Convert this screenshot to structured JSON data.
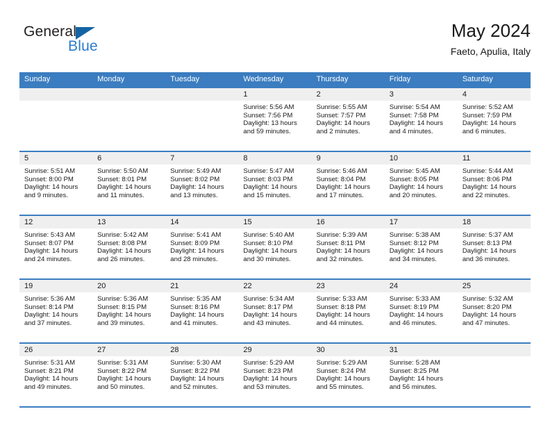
{
  "brand": {
    "name_part1": "General",
    "name_part2": "Blue",
    "logo_icon": "blue-triangle"
  },
  "header": {
    "title": "May 2024",
    "subtitle": "Faeto, Apulia, Italy"
  },
  "weekdays": [
    "Sunday",
    "Monday",
    "Tuesday",
    "Wednesday",
    "Thursday",
    "Friday",
    "Saturday"
  ],
  "colors": {
    "header_blue": "#3b7dc0",
    "daynum_band": "#efefef",
    "logo_blue": "#2b7cc9",
    "text": "#1a1a1a"
  },
  "weeks": [
    [
      {
        "day": ""
      },
      {
        "day": ""
      },
      {
        "day": ""
      },
      {
        "day": "1",
        "sunrise": "Sunrise: 5:56 AM",
        "sunset": "Sunset: 7:56 PM",
        "daylight_1": "Daylight: 13 hours",
        "daylight_2": "and 59 minutes."
      },
      {
        "day": "2",
        "sunrise": "Sunrise: 5:55 AM",
        "sunset": "Sunset: 7:57 PM",
        "daylight_1": "Daylight: 14 hours",
        "daylight_2": "and 2 minutes."
      },
      {
        "day": "3",
        "sunrise": "Sunrise: 5:54 AM",
        "sunset": "Sunset: 7:58 PM",
        "daylight_1": "Daylight: 14 hours",
        "daylight_2": "and 4 minutes."
      },
      {
        "day": "4",
        "sunrise": "Sunrise: 5:52 AM",
        "sunset": "Sunset: 7:59 PM",
        "daylight_1": "Daylight: 14 hours",
        "daylight_2": "and 6 minutes."
      }
    ],
    [
      {
        "day": "5",
        "sunrise": "Sunrise: 5:51 AM",
        "sunset": "Sunset: 8:00 PM",
        "daylight_1": "Daylight: 14 hours",
        "daylight_2": "and 9 minutes."
      },
      {
        "day": "6",
        "sunrise": "Sunrise: 5:50 AM",
        "sunset": "Sunset: 8:01 PM",
        "daylight_1": "Daylight: 14 hours",
        "daylight_2": "and 11 minutes."
      },
      {
        "day": "7",
        "sunrise": "Sunrise: 5:49 AM",
        "sunset": "Sunset: 8:02 PM",
        "daylight_1": "Daylight: 14 hours",
        "daylight_2": "and 13 minutes."
      },
      {
        "day": "8",
        "sunrise": "Sunrise: 5:47 AM",
        "sunset": "Sunset: 8:03 PM",
        "daylight_1": "Daylight: 14 hours",
        "daylight_2": "and 15 minutes."
      },
      {
        "day": "9",
        "sunrise": "Sunrise: 5:46 AM",
        "sunset": "Sunset: 8:04 PM",
        "daylight_1": "Daylight: 14 hours",
        "daylight_2": "and 17 minutes."
      },
      {
        "day": "10",
        "sunrise": "Sunrise: 5:45 AM",
        "sunset": "Sunset: 8:05 PM",
        "daylight_1": "Daylight: 14 hours",
        "daylight_2": "and 20 minutes."
      },
      {
        "day": "11",
        "sunrise": "Sunrise: 5:44 AM",
        "sunset": "Sunset: 8:06 PM",
        "daylight_1": "Daylight: 14 hours",
        "daylight_2": "and 22 minutes."
      }
    ],
    [
      {
        "day": "12",
        "sunrise": "Sunrise: 5:43 AM",
        "sunset": "Sunset: 8:07 PM",
        "daylight_1": "Daylight: 14 hours",
        "daylight_2": "and 24 minutes."
      },
      {
        "day": "13",
        "sunrise": "Sunrise: 5:42 AM",
        "sunset": "Sunset: 8:08 PM",
        "daylight_1": "Daylight: 14 hours",
        "daylight_2": "and 26 minutes."
      },
      {
        "day": "14",
        "sunrise": "Sunrise: 5:41 AM",
        "sunset": "Sunset: 8:09 PM",
        "daylight_1": "Daylight: 14 hours",
        "daylight_2": "and 28 minutes."
      },
      {
        "day": "15",
        "sunrise": "Sunrise: 5:40 AM",
        "sunset": "Sunset: 8:10 PM",
        "daylight_1": "Daylight: 14 hours",
        "daylight_2": "and 30 minutes."
      },
      {
        "day": "16",
        "sunrise": "Sunrise: 5:39 AM",
        "sunset": "Sunset: 8:11 PM",
        "daylight_1": "Daylight: 14 hours",
        "daylight_2": "and 32 minutes."
      },
      {
        "day": "17",
        "sunrise": "Sunrise: 5:38 AM",
        "sunset": "Sunset: 8:12 PM",
        "daylight_1": "Daylight: 14 hours",
        "daylight_2": "and 34 minutes."
      },
      {
        "day": "18",
        "sunrise": "Sunrise: 5:37 AM",
        "sunset": "Sunset: 8:13 PM",
        "daylight_1": "Daylight: 14 hours",
        "daylight_2": "and 36 minutes."
      }
    ],
    [
      {
        "day": "19",
        "sunrise": "Sunrise: 5:36 AM",
        "sunset": "Sunset: 8:14 PM",
        "daylight_1": "Daylight: 14 hours",
        "daylight_2": "and 37 minutes."
      },
      {
        "day": "20",
        "sunrise": "Sunrise: 5:36 AM",
        "sunset": "Sunset: 8:15 PM",
        "daylight_1": "Daylight: 14 hours",
        "daylight_2": "and 39 minutes."
      },
      {
        "day": "21",
        "sunrise": "Sunrise: 5:35 AM",
        "sunset": "Sunset: 8:16 PM",
        "daylight_1": "Daylight: 14 hours",
        "daylight_2": "and 41 minutes."
      },
      {
        "day": "22",
        "sunrise": "Sunrise: 5:34 AM",
        "sunset": "Sunset: 8:17 PM",
        "daylight_1": "Daylight: 14 hours",
        "daylight_2": "and 43 minutes."
      },
      {
        "day": "23",
        "sunrise": "Sunrise: 5:33 AM",
        "sunset": "Sunset: 8:18 PM",
        "daylight_1": "Daylight: 14 hours",
        "daylight_2": "and 44 minutes."
      },
      {
        "day": "24",
        "sunrise": "Sunrise: 5:33 AM",
        "sunset": "Sunset: 8:19 PM",
        "daylight_1": "Daylight: 14 hours",
        "daylight_2": "and 46 minutes."
      },
      {
        "day": "25",
        "sunrise": "Sunrise: 5:32 AM",
        "sunset": "Sunset: 8:20 PM",
        "daylight_1": "Daylight: 14 hours",
        "daylight_2": "and 47 minutes."
      }
    ],
    [
      {
        "day": "26",
        "sunrise": "Sunrise: 5:31 AM",
        "sunset": "Sunset: 8:21 PM",
        "daylight_1": "Daylight: 14 hours",
        "daylight_2": "and 49 minutes."
      },
      {
        "day": "27",
        "sunrise": "Sunrise: 5:31 AM",
        "sunset": "Sunset: 8:22 PM",
        "daylight_1": "Daylight: 14 hours",
        "daylight_2": "and 50 minutes."
      },
      {
        "day": "28",
        "sunrise": "Sunrise: 5:30 AM",
        "sunset": "Sunset: 8:22 PM",
        "daylight_1": "Daylight: 14 hours",
        "daylight_2": "and 52 minutes."
      },
      {
        "day": "29",
        "sunrise": "Sunrise: 5:29 AM",
        "sunset": "Sunset: 8:23 PM",
        "daylight_1": "Daylight: 14 hours",
        "daylight_2": "and 53 minutes."
      },
      {
        "day": "30",
        "sunrise": "Sunrise: 5:29 AM",
        "sunset": "Sunset: 8:24 PM",
        "daylight_1": "Daylight: 14 hours",
        "daylight_2": "and 55 minutes."
      },
      {
        "day": "31",
        "sunrise": "Sunrise: 5:28 AM",
        "sunset": "Sunset: 8:25 PM",
        "daylight_1": "Daylight: 14 hours",
        "daylight_2": "and 56 minutes."
      },
      {
        "day": ""
      }
    ]
  ]
}
